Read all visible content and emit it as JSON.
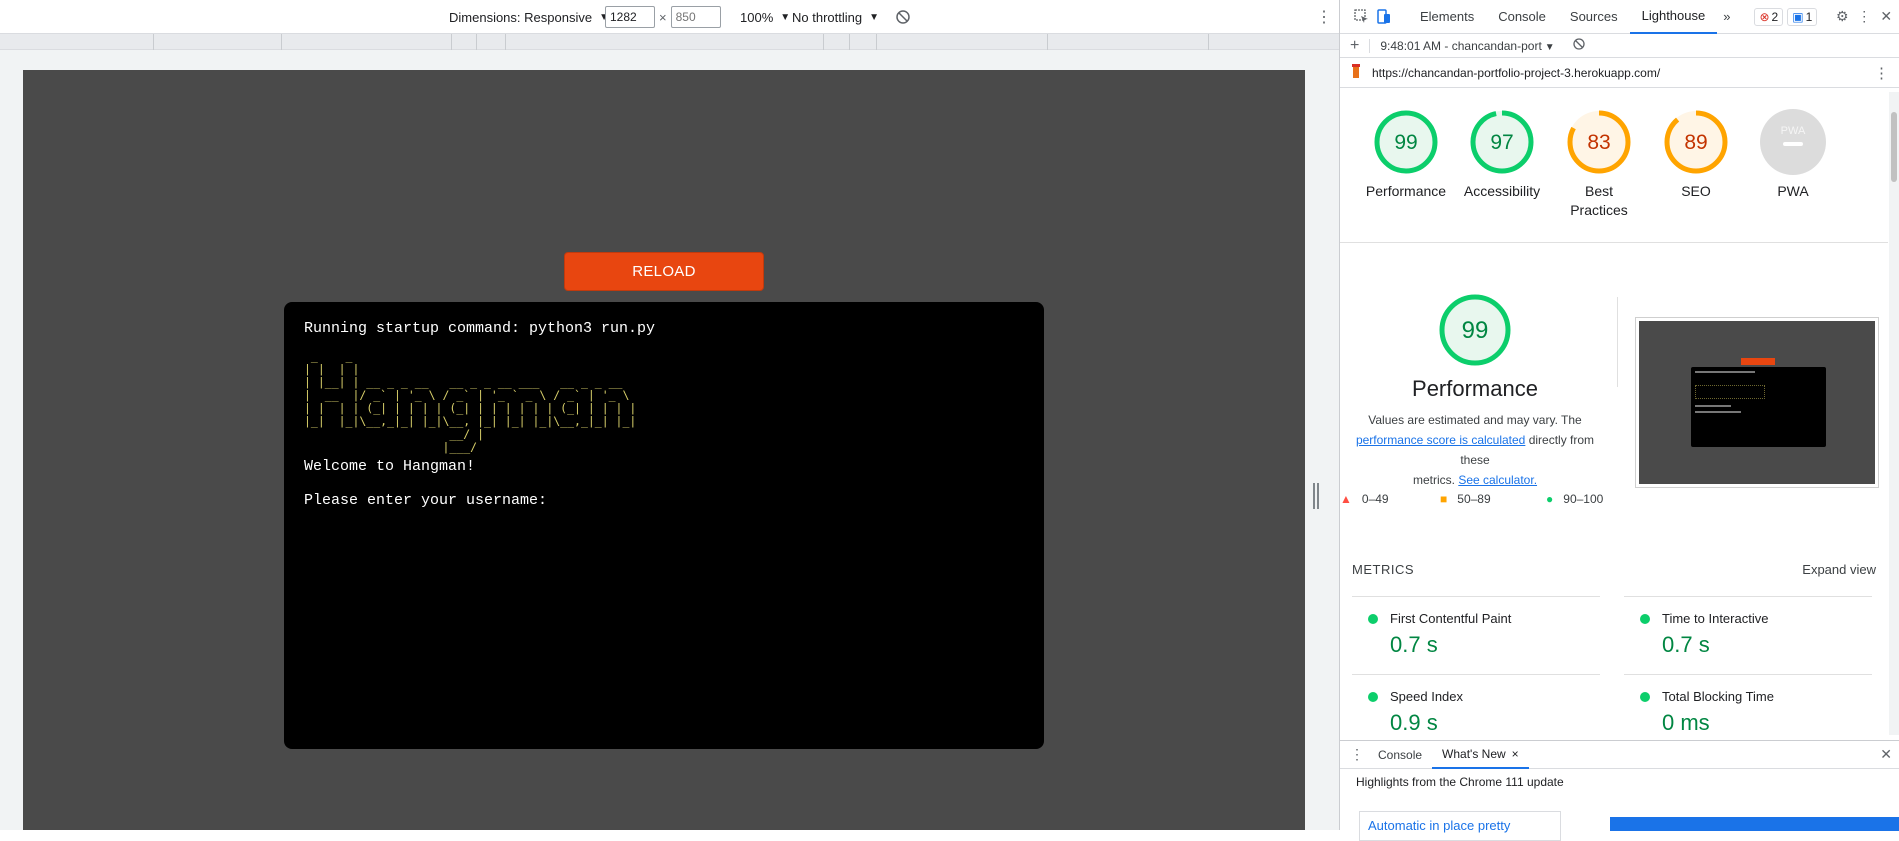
{
  "devbar": {
    "dimensions_label": "Dimensions: Responsive",
    "width_value": "1282",
    "times": "×",
    "height_placeholder": "850",
    "zoom": "100%",
    "throttling": "No throttling"
  },
  "page": {
    "reload_label": "RELOAD",
    "terminal_lines": {
      "startup": "Running startup command: python3 run.py",
      "ascii_art": " _    _\n| |  | |\n| |__| | __ _ _ __   __ _ _ __ ___   __ _ _ __\n|  __  |/ _` | '_ \\ / _` | '_ ` _ \\ / _` | '_ \\\n| |  | | (_| | | | | (_| | | | | | | (_| | | | |\n|_|  |_|\\__,_|_| |_|\\__, |_| |_| |_|\\__,_|_| |_|\n                     __/ |\n                    |___/",
      "welcome": "Welcome to Hangman!",
      "prompt": "Please enter your username:"
    }
  },
  "devtools": {
    "tabs": [
      "Elements",
      "Console",
      "Sources",
      "Lighthouse"
    ],
    "more": "»",
    "errors_count": "2",
    "messages_count": "1",
    "report_time": "9:48:01 AM - chancandan-port",
    "url": "https://chancandan-portfolio-project-3.herokuapp.com/",
    "colors": {
      "pass": "#0cce6b",
      "average": "#ffa400",
      "fail": "#ff4e42",
      "pass_text": "#018642",
      "average_text": "#c33300"
    }
  },
  "scores": [
    {
      "value": "99",
      "label": "Performance",
      "status": "pass"
    },
    {
      "value": "97",
      "label": "Accessibility",
      "status": "pass"
    },
    {
      "value": "83",
      "label": "Best Practices",
      "status": "average"
    },
    {
      "value": "89",
      "label": "SEO",
      "status": "average"
    },
    {
      "value": "PWA",
      "label": "PWA",
      "status": "na"
    }
  ],
  "performance": {
    "score": "99",
    "title": "Performance",
    "desc_1": "Values are estimated and may vary. The",
    "link_1": "performance score is calculated",
    "desc_2": "directly from these",
    "desc_3": "metrics.",
    "link_2": "See calculator.",
    "legend": {
      "fail": "0–49",
      "average": "50–89",
      "pass": "90–100"
    }
  },
  "metrics": {
    "heading": "METRICS",
    "expand": "Expand view",
    "items": [
      {
        "name": "First Contentful Paint",
        "value": "0.7 s"
      },
      {
        "name": "Time to Interactive",
        "value": "0.7 s"
      },
      {
        "name": "Speed Index",
        "value": "0.9 s"
      },
      {
        "name": "Total Blocking Time",
        "value": "0 ms"
      }
    ]
  },
  "drawer": {
    "tabs": [
      "Console",
      "What's New"
    ],
    "close": "×",
    "highlight": "Highlights from the Chrome 111 update",
    "card_title": "Automatic in place pretty"
  }
}
